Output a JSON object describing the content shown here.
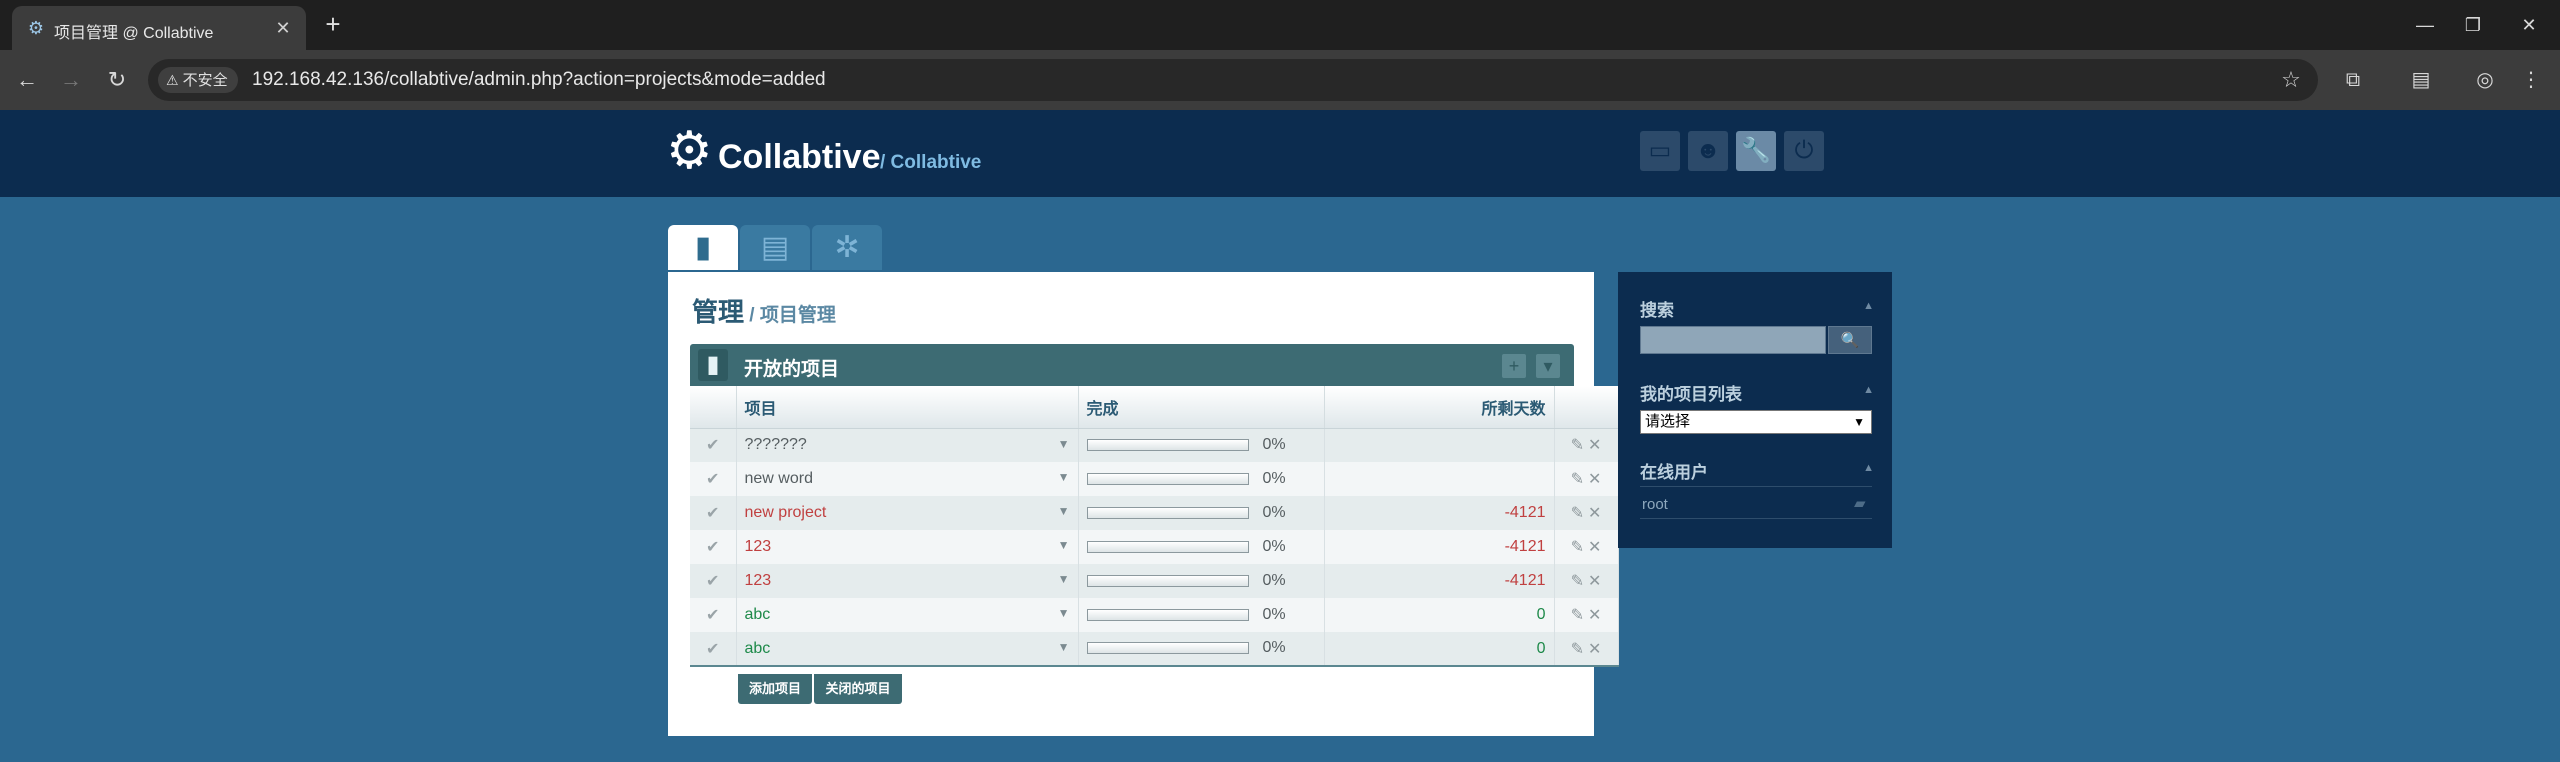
{
  "browser": {
    "tab_title": "项目管理 @ Collabtive",
    "insecure_label": "不安全",
    "url": "192.168.42.136/collabtive/admin.php?action=projects&mode=added"
  },
  "app": {
    "logo_text": "Collabtive",
    "logo_sub": "/ Collabtive"
  },
  "breadcrumb": {
    "main": "管理",
    "sub": " / 项目管理"
  },
  "block": {
    "title": "开放的项目",
    "columns": {
      "project": "项目",
      "done": "完成",
      "days_left": "所剩天数"
    }
  },
  "projects": [
    {
      "name": "???????",
      "progress_percent": 0,
      "progress_label": "0%",
      "days_left": "",
      "status": "grey"
    },
    {
      "name": "new word",
      "progress_percent": 0,
      "progress_label": "0%",
      "days_left": "",
      "status": "grey"
    },
    {
      "name": "new project",
      "progress_percent": 0,
      "progress_label": "0%",
      "days_left": "-4121",
      "status": "red"
    },
    {
      "name": "123",
      "progress_percent": 0,
      "progress_label": "0%",
      "days_left": "-4121",
      "status": "red"
    },
    {
      "name": "123",
      "progress_percent": 0,
      "progress_label": "0%",
      "days_left": "-4121",
      "status": "red"
    },
    {
      "name": "abc",
      "progress_percent": 0,
      "progress_label": "0%",
      "days_left": "0",
      "status": "green"
    },
    {
      "name": "abc",
      "progress_percent": 0,
      "progress_label": "0%",
      "days_left": "0",
      "status": "green"
    }
  ],
  "actions": {
    "add_project": "添加项目",
    "closed_projects": "关闭的项目"
  },
  "sidebar": {
    "search_title": "搜索",
    "my_projects_title": "我的项目列表",
    "my_projects_selected": "请选择",
    "online_title": "在线用户",
    "online_users": [
      "root"
    ]
  },
  "colors": {
    "header_bg": "#0c2c4f",
    "page_bg": "#2b6790",
    "block_head": "#3d6b73",
    "overdue": "#c04040",
    "on_time": "#1e8a4a"
  },
  "icons": {
    "tab_favicon": "gear-icon",
    "header_buttons": [
      "desktop-icon",
      "user-icon",
      "wrench-icon",
      "power-icon"
    ],
    "content_tabs": [
      "projects-icon",
      "clipboard-icon",
      "settings-icon"
    ],
    "row_check": "check-icon",
    "row_edit": "pencil-icon",
    "row_delete": "close-icon"
  }
}
